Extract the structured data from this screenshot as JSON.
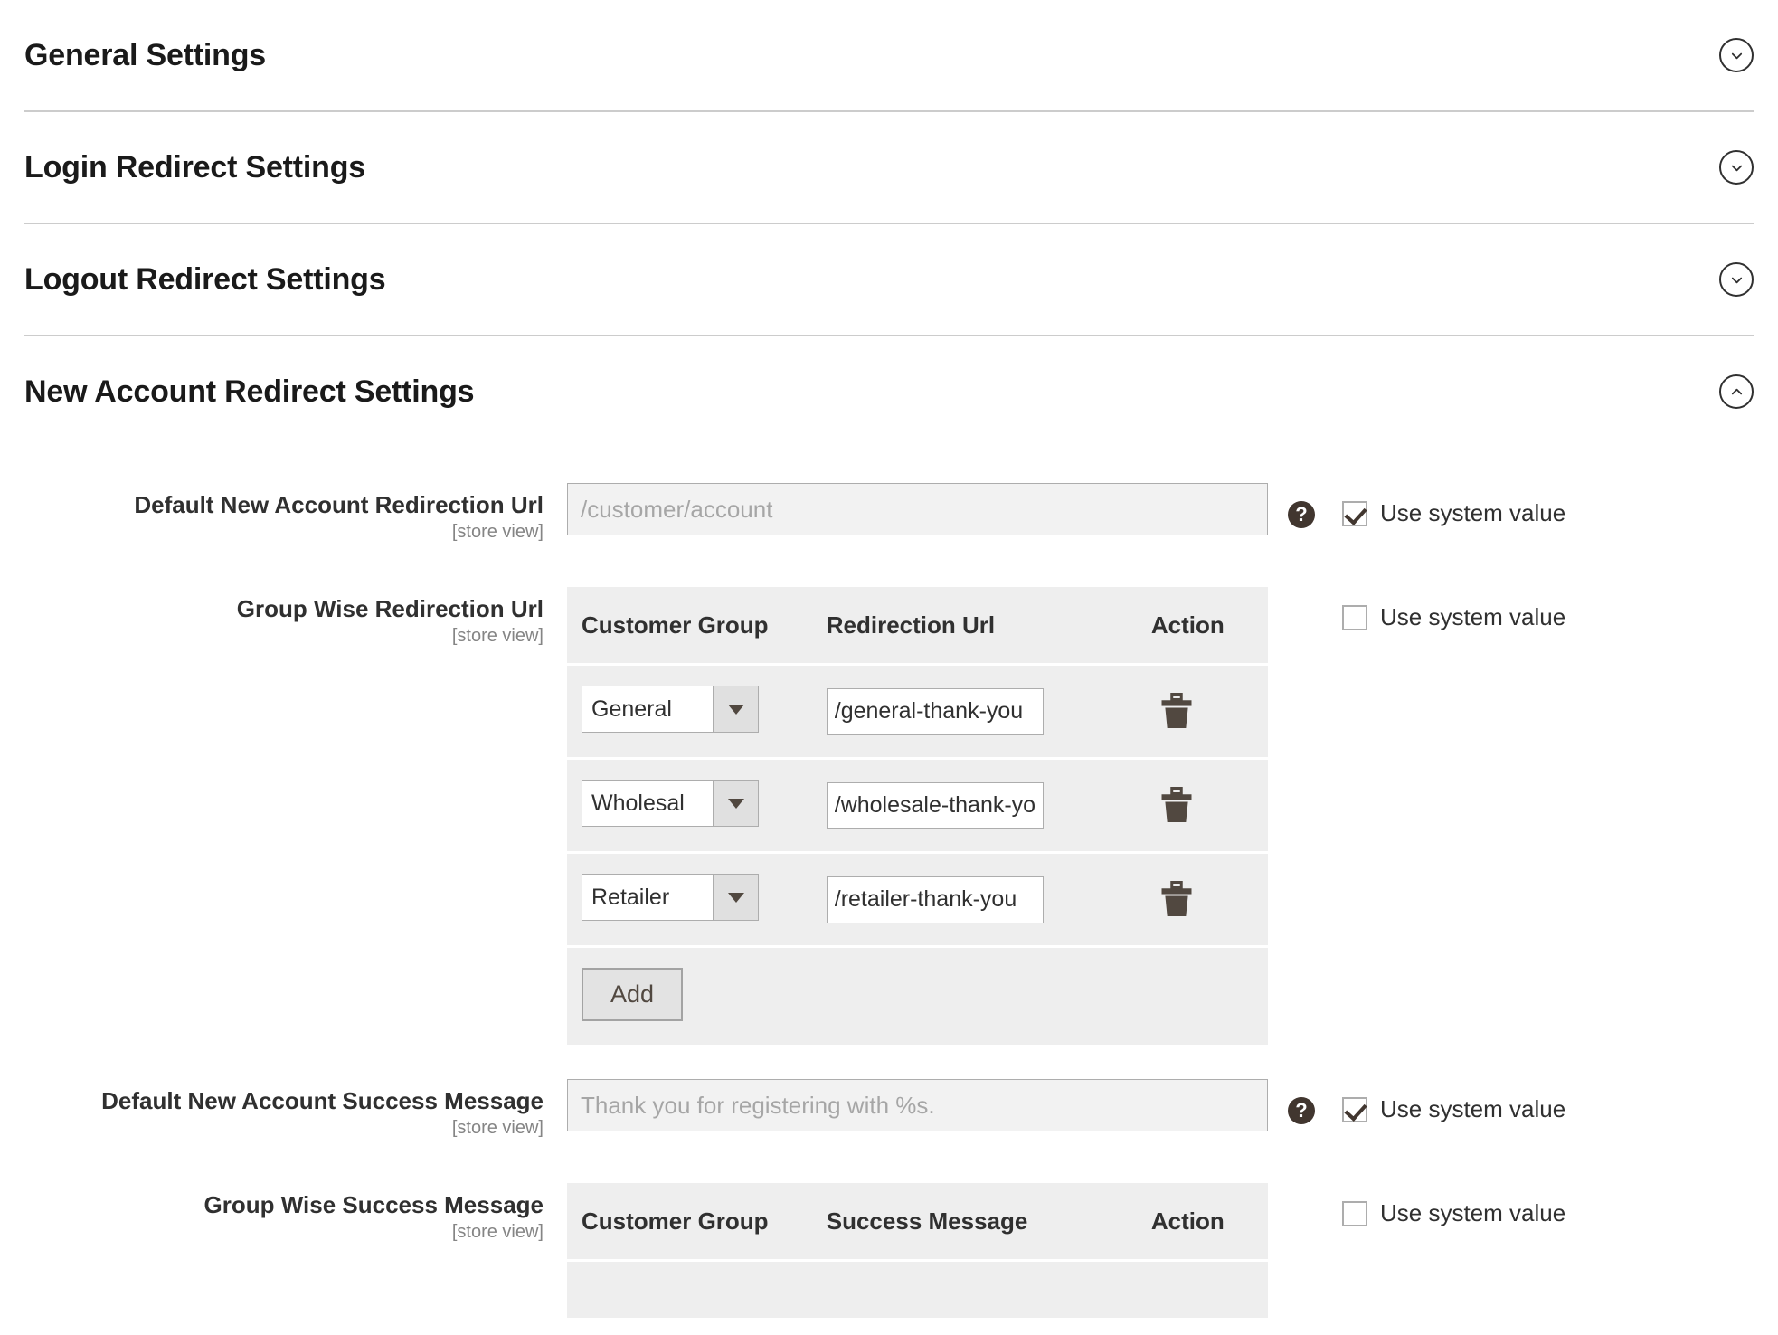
{
  "sections": [
    {
      "title": "General Settings",
      "expanded": false,
      "toggle_icon": "chevron-down-icon"
    },
    {
      "title": "Login Redirect Settings",
      "expanded": false,
      "toggle_icon": "chevron-down-icon"
    },
    {
      "title": "Logout Redirect Settings",
      "expanded": false,
      "toggle_icon": "chevron-down-icon"
    },
    {
      "title": "New Account Redirect Settings",
      "expanded": true,
      "toggle_icon": "chevron-up-icon"
    }
  ],
  "fields": {
    "default_redirect_url": {
      "label": "Default New Account Redirection Url",
      "scope": "[store view]",
      "value": "",
      "placeholder": "/customer/account",
      "help_icon": "question-mark-icon",
      "use_system_value_label": "Use system value",
      "use_system_value_checked": true
    },
    "group_wise_redirect": {
      "label": "Group Wise Redirection Url",
      "scope": "[store view]",
      "use_system_value_label": "Use system value",
      "use_system_value_checked": false,
      "columns": [
        "Customer Group",
        "Redirection Url",
        "Action"
      ],
      "rows": [
        {
          "group": "General",
          "url": "/general-thank-you",
          "action_icon": "trash-icon"
        },
        {
          "group": "Wholesal",
          "url": "/wholesale-thank-you",
          "action_icon": "trash-icon"
        },
        {
          "group": "Retailer",
          "url": "/retailer-thank-you",
          "action_icon": "trash-icon"
        }
      ],
      "add_label": "Add"
    },
    "default_success_message": {
      "label": "Default New Account Success Message",
      "scope": "[store view]",
      "value": "",
      "placeholder": "Thank you for registering with %s.",
      "help_icon": "question-mark-icon",
      "use_system_value_label": "Use system value",
      "use_system_value_checked": true
    },
    "group_wise_success": {
      "label": "Group Wise Success Message",
      "scope": "[store view]",
      "use_system_value_label": "Use system value",
      "use_system_value_checked": false,
      "columns": [
        "Customer Group",
        "Success Message",
        "Action"
      ]
    }
  },
  "colors": {
    "header_text": "#1a1a1a",
    "label_text": "#303030",
    "scope_text": "#858585",
    "table_bg": "#eeeeee",
    "divider": "#cccccc",
    "help_bubble": "#41362f",
    "input_border": "#adadad",
    "disabled_input_bg": "#f2f2f2"
  }
}
